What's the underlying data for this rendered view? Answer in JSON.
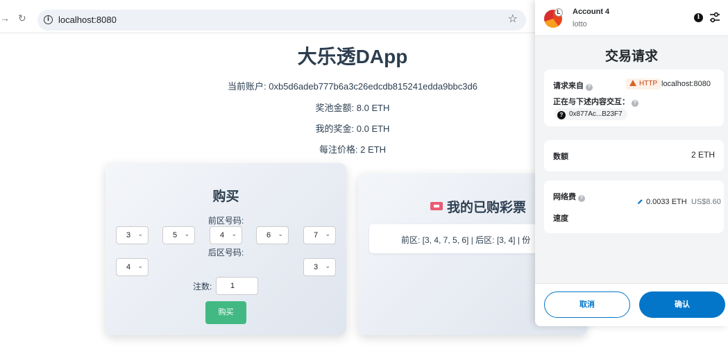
{
  "browser": {
    "url": "localhost:8080",
    "icons": {
      "forward": "arrow-right-icon",
      "reload": "reload-icon",
      "info": "info-icon",
      "bookmark": "star-icon"
    }
  },
  "page": {
    "title": "大乐透DApp",
    "account_line": "当前账户: 0xb5d6adeb777b6a3c26edcdb815241edda9bbc3d6",
    "pool_line": "奖池金额: 8.0 ETH",
    "prize_line": "我的奖金: 0.0 ETH",
    "price_line": "每注价格: 2 ETH"
  },
  "buy": {
    "title": "购买",
    "front_label": "前区号码:",
    "front_numbers": [
      "3",
      "5",
      "4",
      "6",
      "7"
    ],
    "back_label": "后区号码:",
    "back_numbers": [
      "4",
      "3"
    ],
    "quantity_label": "注数:",
    "quantity_value": "1",
    "buy_button": "购买",
    "accent_color": "#42b983"
  },
  "tickets": {
    "title": "我的已购彩票",
    "rows": [
      "前区: [3, 4, 7, 5, 6] | 后区: [3, 4] | 份"
    ]
  },
  "wallet": {
    "account_name": "Account 4",
    "network_name": "lotto",
    "avatar_badge": "L",
    "title": "交易请求",
    "request_from_label": "请求来自",
    "http_badge": "HTTP",
    "origin": "localhost:8080",
    "interacting_label": "正在与下述内容交互：",
    "contract_address": "0x877Ac...B23F7",
    "amount_label": "数额",
    "amount_value": "2 ETH",
    "fee_label": "网络费",
    "fee_eth": "0.0033 ETH",
    "fee_usd": "US$8.60",
    "speed_label": "速度",
    "cancel_button": "取消",
    "confirm_button": "确认",
    "primary_color": "#0376c9"
  }
}
